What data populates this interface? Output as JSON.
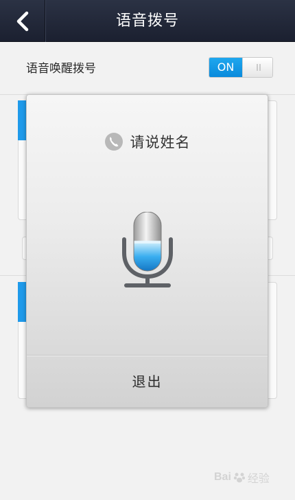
{
  "header": {
    "title": "语音拨号",
    "back_icon": "chevron-left-icon"
  },
  "settings": {
    "voice_wake_label": "语音唤醒拨号",
    "voice_wake_toggle": {
      "state_label": "ON",
      "state": "on",
      "knob_icon": "grip-lines-icon"
    }
  },
  "dialog": {
    "prompt_icon": "phone-icon",
    "prompt_text": "请说姓名",
    "mic_icon": "microphone-icon",
    "exit_label": "退出"
  },
  "watermark": {
    "brand": "Bai",
    "suffix": "经验"
  },
  "colors": {
    "header_bg": "#1f2433",
    "accent_blue": "#1fa7ee",
    "page_bg": "#f2f2f2"
  }
}
